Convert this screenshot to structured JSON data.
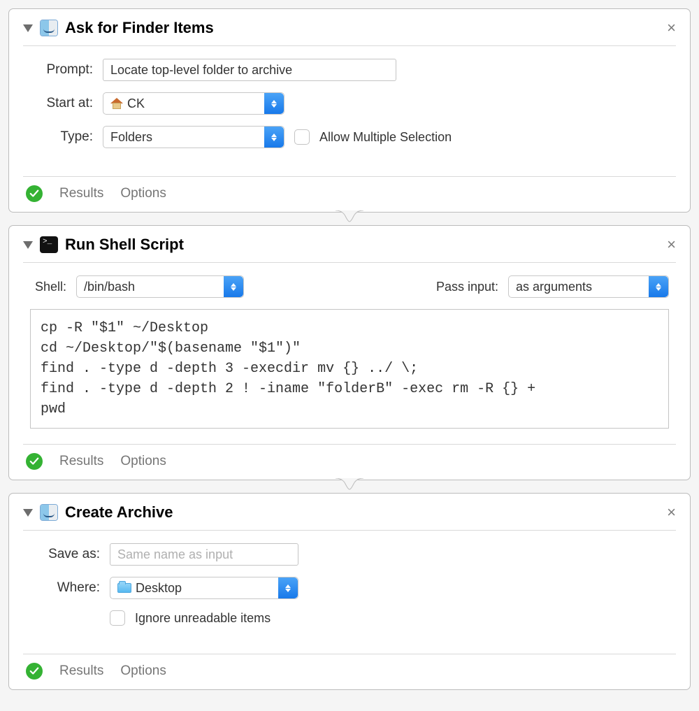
{
  "actions": {
    "ask": {
      "title": "Ask for Finder Items",
      "prompt_label": "Prompt:",
      "prompt_value": "Locate top-level folder to archive",
      "start_label": "Start at:",
      "start_value": "CK",
      "type_label": "Type:",
      "type_value": "Folders",
      "allow_multi_label": "Allow Multiple Selection"
    },
    "shell": {
      "title": "Run Shell Script",
      "shell_label": "Shell:",
      "shell_value": "/bin/bash",
      "pass_label": "Pass input:",
      "pass_value": "as arguments",
      "script": "cp -R \"$1\" ~/Desktop\ncd ~/Desktop/\"$(basename \"$1\")\"\nfind . -type d -depth 3 -execdir mv {} ../ \\;\nfind . -type d -depth 2 ! -iname \"folderB\" -exec rm -R {} +\npwd"
    },
    "archive": {
      "title": "Create Archive",
      "save_label": "Save as:",
      "save_placeholder": "Same name as input",
      "where_label": "Where:",
      "where_value": "Desktop",
      "ignore_label": "Ignore unreadable items"
    }
  },
  "footer": {
    "results": "Results",
    "options": "Options"
  },
  "close_glyph": "×"
}
